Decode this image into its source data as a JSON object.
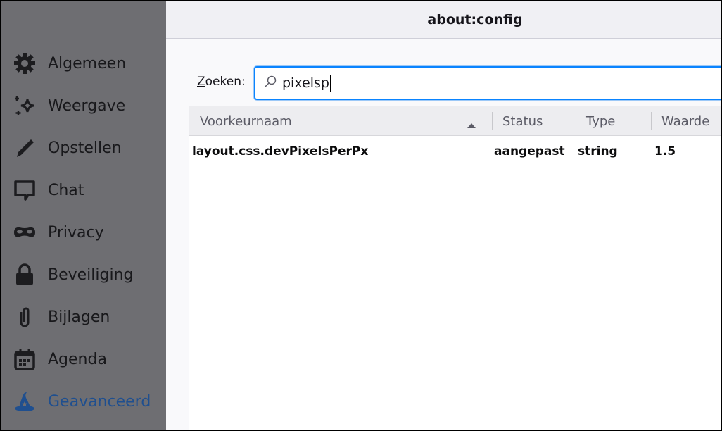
{
  "window": {
    "title": "about:config"
  },
  "sidebar": {
    "items": [
      {
        "label": "Algemeen",
        "icon": "gear-icon"
      },
      {
        "label": "Weergave",
        "icon": "sparkles-icon"
      },
      {
        "label": "Opstellen",
        "icon": "pencil-icon"
      },
      {
        "label": "Chat",
        "icon": "chat-bubble-icon"
      },
      {
        "label": "Privacy",
        "icon": "mask-icon"
      },
      {
        "label": "Beveiliging",
        "icon": "lock-icon"
      },
      {
        "label": "Bijlagen",
        "icon": "paperclip-icon"
      },
      {
        "label": "Agenda",
        "icon": "calendar-icon"
      },
      {
        "label": "Geavanceerd",
        "icon": "wizard-hat-icon",
        "active": true
      }
    ],
    "active_color": "#1f4f8f"
  },
  "search": {
    "label_accesskey": "Z",
    "label_rest": "oeken:",
    "value": "pixelsp"
  },
  "table": {
    "columns": [
      "Voorkeurnaam",
      "Status",
      "Type",
      "Waarde"
    ],
    "sort": "ascending",
    "rows": [
      {
        "name": "layout.css.devPixelsPerPx",
        "status": "aangepast",
        "type": "string",
        "value": "1.5"
      }
    ]
  }
}
